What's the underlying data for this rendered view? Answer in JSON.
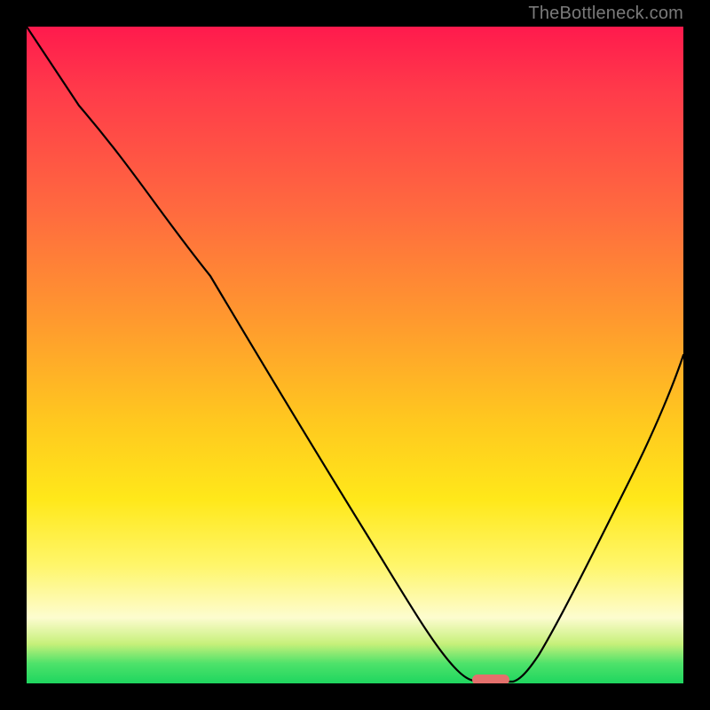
{
  "watermark": {
    "text": "TheBottleneck.com"
  },
  "chart_data": {
    "type": "line",
    "title": "",
    "xlabel": "",
    "ylabel": "",
    "xlim": [
      0,
      100
    ],
    "ylim": [
      0,
      100
    ],
    "grid": false,
    "series": [
      {
        "name": "bottleneck-curve",
        "x": [
          0,
          8,
          18,
          28,
          38,
          48,
          58,
          64,
          67,
          70,
          74,
          78,
          84,
          90,
          96,
          100
        ],
        "y": [
          100,
          88,
          78,
          62,
          46,
          30,
          14,
          4,
          1,
          0,
          0,
          3,
          12,
          25,
          40,
          50
        ]
      }
    ],
    "marker": {
      "x": 71,
      "y": 0,
      "color": "#e4706c",
      "shape": "pill"
    },
    "gradient_stops": [
      {
        "pos": 0.0,
        "color": "#ff1a4d"
      },
      {
        "pos": 0.1,
        "color": "#ff3b4a"
      },
      {
        "pos": 0.28,
        "color": "#ff6a3f"
      },
      {
        "pos": 0.45,
        "color": "#ff9a2e"
      },
      {
        "pos": 0.6,
        "color": "#ffc81f"
      },
      {
        "pos": 0.72,
        "color": "#ffe81a"
      },
      {
        "pos": 0.82,
        "color": "#fff66a"
      },
      {
        "pos": 0.9,
        "color": "#fdfccf"
      },
      {
        "pos": 0.94,
        "color": "#c6f07a"
      },
      {
        "pos": 0.97,
        "color": "#4de26a"
      },
      {
        "pos": 1.0,
        "color": "#1fd65f"
      }
    ]
  }
}
